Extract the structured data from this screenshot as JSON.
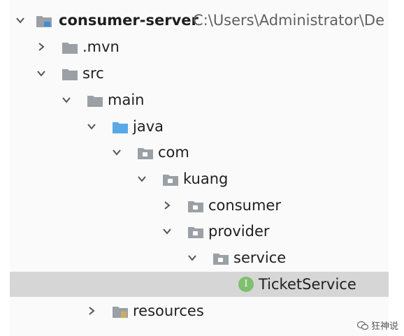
{
  "project": {
    "name": "consumer-server",
    "path": "C:\\Users\\Administrator\\De"
  },
  "nodes": {
    "mvn": ".mvn",
    "src": "src",
    "main": "main",
    "java": "java",
    "com": "com",
    "kuang": "kuang",
    "consumer": "consumer",
    "provider": "provider",
    "service": "service",
    "ticket_service": "TicketService",
    "resources": "resources"
  },
  "interface_badge": "I",
  "watermark": "狂神说",
  "colors": {
    "selected_row": "#d6d6d6",
    "folder": "#9aa0a6",
    "source_folder": "#5aa9e6",
    "interface_badge": "#7fbf6e"
  }
}
